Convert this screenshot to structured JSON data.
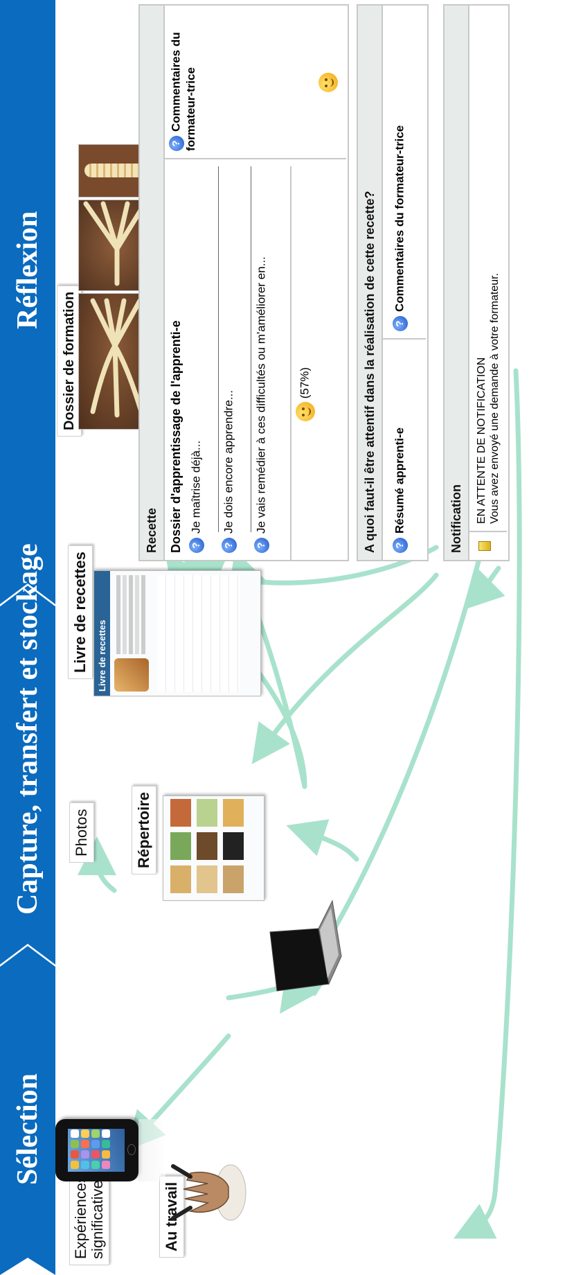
{
  "band": {
    "stages": [
      "Sélection",
      "Capture, transfert et stockage",
      "Réflexion"
    ],
    "fill_color": "#0a6bbf"
  },
  "left": {
    "experiences_label": "Expériences\nsignificatives",
    "work_label": "Au travail",
    "photos_label": "Photos",
    "repertoire_label": "Répertoire"
  },
  "mid": {
    "cookbook_label": "Livre de recettes",
    "cookbook_title": "Livre de recettes"
  },
  "training_file_label": "Dossier de formation",
  "recipe_panel": {
    "header": "Recette",
    "left_title": "Dossier d'apprentissage de l'apprenti-e",
    "right_title": "Commentaires du formateur-trice",
    "rows": [
      "Je maîtrise déjà...",
      "Je dois encore apprendre...",
      "Je vais remédier à ces difficultés ou m'améliorer en..."
    ],
    "score": "(57%)"
  },
  "attention_panel": {
    "header": "A quoi faut-il être attentif dans la réalisation de cette recette?",
    "left_title": "Résumé apprenti-e",
    "right_title": "Commentaires du formateur-trice"
  },
  "notification_panel": {
    "header": "Notification",
    "status": "EN ATTENTE DE NOTIFICATION",
    "message": "Vous avez envoyé une demande à votre formateur."
  },
  "arrow_color": "#a8e2cc"
}
